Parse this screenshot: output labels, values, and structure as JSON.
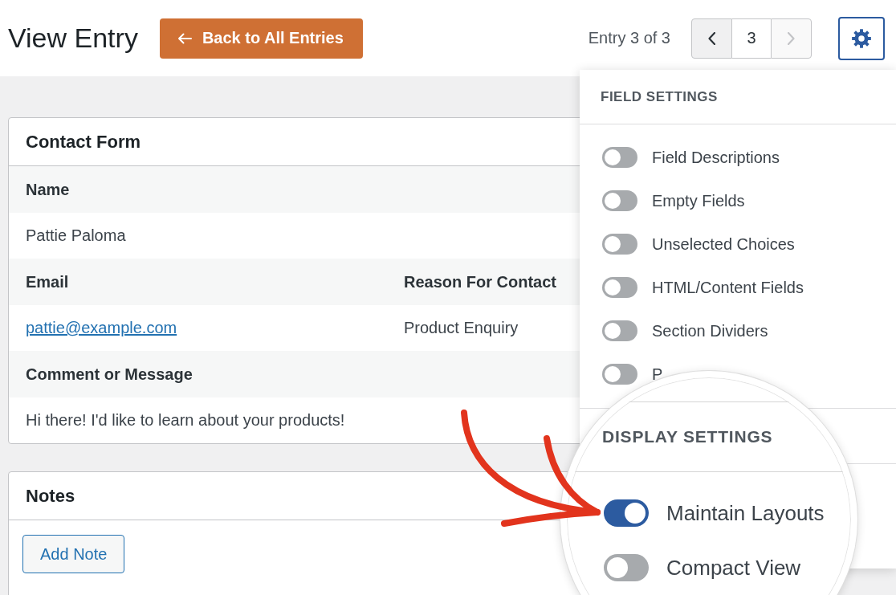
{
  "header": {
    "title": "View Entry",
    "back_button": "Back to All Entries"
  },
  "pagination": {
    "label": "Entry 3 of 3",
    "previous": {
      "disabled": false
    },
    "current": "3",
    "next": {
      "disabled": true
    }
  },
  "settings_button": {
    "expanded": true
  },
  "entry_card": {
    "title": "Contact Form",
    "rows": [
      {
        "fields": [
          {
            "label": "Name",
            "value": "Pattie Paloma",
            "kind": "text"
          }
        ]
      },
      {
        "fields": [
          {
            "label": "Email",
            "value": "pattie@example.com",
            "kind": "link"
          },
          {
            "label": "Reason For Contact",
            "value": "Product Enquiry",
            "kind": "text"
          }
        ]
      },
      {
        "fields": [
          {
            "label": "Comment or Message",
            "value": "Hi there! I'd like to learn about your products!",
            "kind": "text"
          }
        ]
      }
    ]
  },
  "notes_card": {
    "title": "Notes",
    "button": "Add Note"
  },
  "settings_menu": {
    "title": "FIELD SETTINGS",
    "options": [
      {
        "label": "Field Descriptions",
        "on": false
      },
      {
        "label": "Empty Fields",
        "on": false
      },
      {
        "label": "Unselected Choices",
        "on": false
      },
      {
        "label": "HTML/Content Fields",
        "on": false
      },
      {
        "label": "Section Dividers",
        "on": false
      },
      {
        "label": "P",
        "on": false
      }
    ]
  },
  "magnifier": {
    "title": "DISPLAY SETTINGS",
    "options": [
      {
        "label": "Maintain Layouts",
        "on": true
      },
      {
        "label": "Compact View",
        "on": false
      }
    ]
  }
}
